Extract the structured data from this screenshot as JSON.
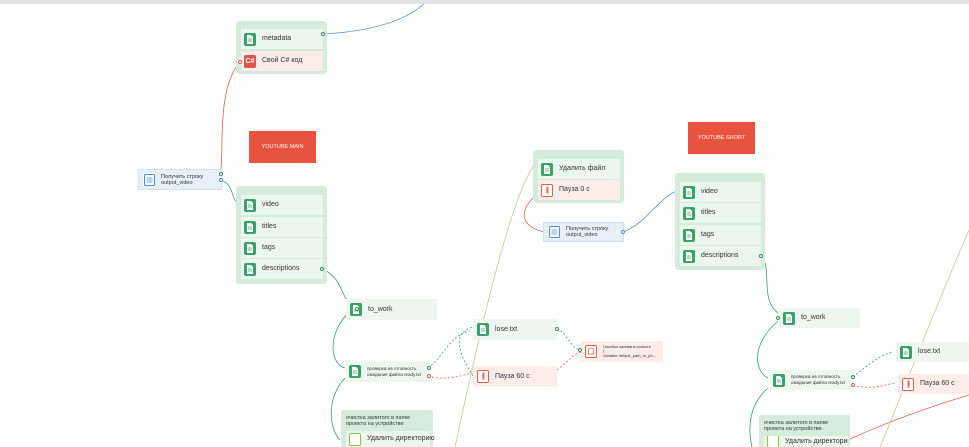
{
  "colors": {
    "green": "#3aa16a",
    "red": "#e25c4b",
    "blue": "#4a90d9",
    "banner": "#e8533f",
    "olive": "#c9c29a"
  },
  "left_flow": {
    "meta_group": {
      "metadata": "metadata",
      "csharp": "Свой C# код",
      "csharp_icon": "C#"
    },
    "banner": "YOUTUBE MAIN",
    "get_string": {
      "line1": "Получить строку",
      "line2": "output_video"
    },
    "files": [
      "video",
      "titles",
      "tags",
      "descriptions"
    ],
    "to_work": "to_work",
    "check_ready": {
      "line1": "проверка на готовность",
      "line2": "ожидание файла ready.txt"
    },
    "lose": "lose.txt",
    "pause": "Пауза 60 с",
    "error": {
      "line1": "Ошибка залива в проекте",
      "line2": "{",
      "line3": "Variable.default_path_to_ph..."
    },
    "cleanup": {
      "line1": "очистка залитого в папке",
      "line2": "проекта на устройстве",
      "delete_dir": "Удалить директорию"
    }
  },
  "middle_flow": {
    "delete_file": "Удалить файл",
    "pause": "Пауза 0 с",
    "get_string": {
      "line1": "Получить строку",
      "line2": "output_video"
    }
  },
  "right_flow": {
    "banner": "YOUTUBE SHORT",
    "files": [
      "video",
      "titles",
      "tags",
      "descriptions"
    ],
    "to_work": "to_work",
    "check_ready": {
      "line1": "проверка на готовность",
      "line2": "ожидание файла ready.txt"
    },
    "lose": "lose.txt",
    "pause": "Пауза 60 с",
    "cleanup": {
      "line1": "очистка залитого в папке",
      "line2": "проекта на устройстве",
      "delete_dir": "Удалить директорию"
    }
  }
}
